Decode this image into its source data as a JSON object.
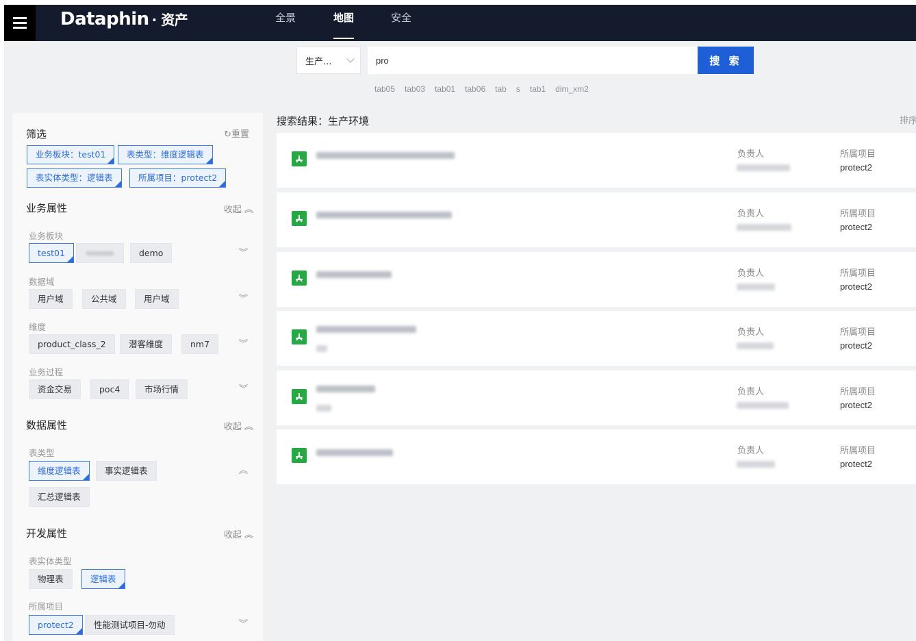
{
  "header": {
    "brand": "Dataphin",
    "brand_sub": "· 资产",
    "tabs": [
      {
        "label": "全景",
        "active": false
      },
      {
        "label": "地图",
        "active": true
      },
      {
        "label": "安全",
        "active": false
      }
    ]
  },
  "search": {
    "env_label": "生产...",
    "query": "pro",
    "button": "搜 索",
    "hints": [
      "tab05",
      "tab03",
      "tab01",
      "tab06",
      "tab",
      "s",
      "tab1",
      "dim_xm2"
    ]
  },
  "filter": {
    "title": "筛选",
    "reset": "重置",
    "active": [
      "业务板块：test01",
      "表类型：维度逻辑表",
      "表实体类型：逻辑表",
      "所属项目：protect2"
    ]
  },
  "sections": {
    "business": {
      "title": "业务属性",
      "collapse": "收起",
      "block_label": "业务板块",
      "blocks": [
        "test01",
        "demo"
      ],
      "domain_label": "数据域",
      "domains": [
        "用户域",
        "公共域",
        "用户域"
      ],
      "dim_label": "维度",
      "dims": [
        "product_class_2",
        "潜客维度",
        "nm7"
      ],
      "process_label": "业务过程",
      "processes": [
        "资金交易",
        "poc4",
        "市场行情"
      ]
    },
    "data": {
      "title": "数据属性",
      "collapse": "收起",
      "type_label": "表类型",
      "types": [
        "维度逻辑表",
        "事实逻辑表",
        "汇总逻辑表"
      ]
    },
    "dev": {
      "title": "开发属性",
      "collapse": "收起",
      "entity_label": "表实体类型",
      "entities": [
        "物理表",
        "逻辑表"
      ],
      "project_label": "所属项目",
      "projects": [
        "protect2",
        "性能测试项目-勿动"
      ]
    }
  },
  "results": {
    "title": "搜索结果：生产环境",
    "sort": "排序",
    "owner_label": "负责人",
    "project_label": "所属项目",
    "items": [
      {
        "project": "protect2"
      },
      {
        "project": "protect2"
      },
      {
        "project": "protect2"
      },
      {
        "project": "protect2"
      },
      {
        "project": "protect2"
      },
      {
        "project": "protect2"
      }
    ]
  },
  "colors": {
    "nav_bg": "#141b2c",
    "accent": "#1e5fd8",
    "file_icon": "#27a844"
  }
}
